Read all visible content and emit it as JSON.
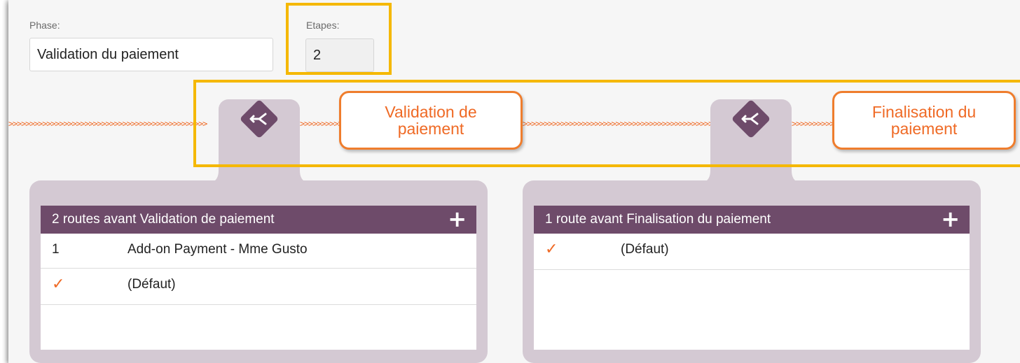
{
  "form": {
    "phase_label": "Phase:",
    "phase_value": "Validation du paiement",
    "etapes_label": "Etapes:",
    "etapes_value": "2"
  },
  "flow": {
    "arrow_text": ">>>>>>>>>>>>>>>>>>>>>>>>>>>>>>>>>>>>>>>>>>>>>>>",
    "steps": [
      {
        "line1": "Validation de",
        "line2": "paiement"
      },
      {
        "line1": "Finalisation du",
        "line2": "paiement"
      }
    ]
  },
  "panels": [
    {
      "title": "2 routes avant Validation de paiement",
      "add_label": "+",
      "rows": [
        {
          "index": "1",
          "name": "Add-on Payment - Mme Gusto"
        },
        {
          "check": "✓",
          "name": "(Défaut)"
        }
      ]
    },
    {
      "title": "1 route avant Finalisation du paiement",
      "add_label": "+",
      "rows": [
        {
          "check": "✓",
          "name": "(Défaut)"
        }
      ]
    }
  ],
  "colors": {
    "accent_orange": "#ef6a25",
    "route_purple": "#6e4b6a",
    "panel_lilac": "#d4c9d3",
    "highlight_yellow": "#f5b800"
  },
  "icons": {
    "route_node": "split-route-icon",
    "add": "plus-icon",
    "default_check": "check-icon"
  }
}
